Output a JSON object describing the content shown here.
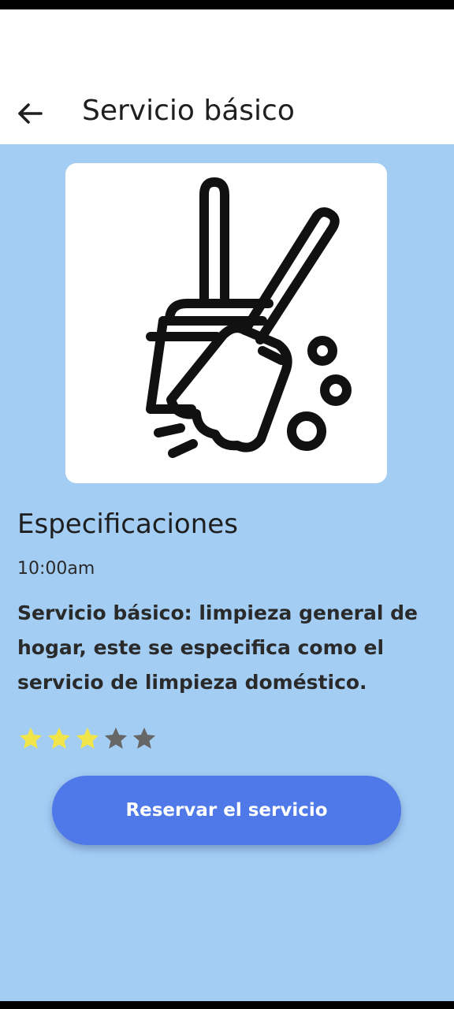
{
  "header": {
    "back_icon": "arrow-left-icon",
    "title": "Servicio básico"
  },
  "service_image": {
    "icon": "broom-dustpan-icon"
  },
  "details": {
    "section_title": "Especificaciones",
    "time": "10:00am",
    "description": "Servicio básico: limpieza general de hogar, este se especifica como el servicio de limpieza doméstico."
  },
  "rating": {
    "value": 3,
    "max": 5,
    "filled_color": "#f2e54a",
    "empty_color": "#666666"
  },
  "actions": {
    "reserve_label": "Reservar el servicio"
  },
  "colors": {
    "background": "#a3cdf3",
    "app_bar": "#ffffff",
    "button": "#4f79e8"
  }
}
